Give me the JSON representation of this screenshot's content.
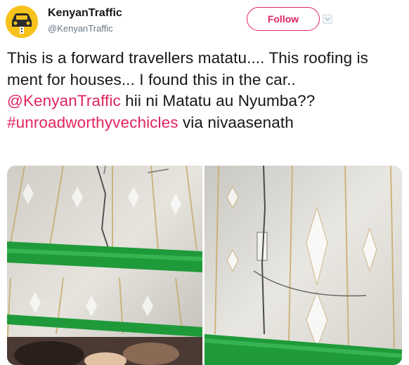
{
  "account": {
    "name": "KenyanTraffic",
    "handle": "@KenyanTraffic",
    "avatar_icon": "traffic-car-logo-icon",
    "avatar_color": "#f6c21b"
  },
  "follow_button": {
    "label": "Follow",
    "color": "#e0245e"
  },
  "more_icon": "chevron-down-icon",
  "tweet": {
    "text_part1": "This is a forward travellers matatu.... This roofing is ment for houses... I found this in the car.. ",
    "mention": "@KenyanTraffic",
    "text_part2": " hii ni Matatu au Nyumba??  ",
    "hashtag": "#unroadworthyvechicles",
    "text_part3": " via nivaasenath"
  },
  "photos": [
    {
      "description": "matatu-ceiling-photo-left"
    },
    {
      "description": "matatu-ceiling-photo-right"
    }
  ],
  "colors": {
    "link": "#e0245e",
    "text": "#14171a",
    "secondary": "#657786",
    "rail_green": "#1f9a3a"
  }
}
